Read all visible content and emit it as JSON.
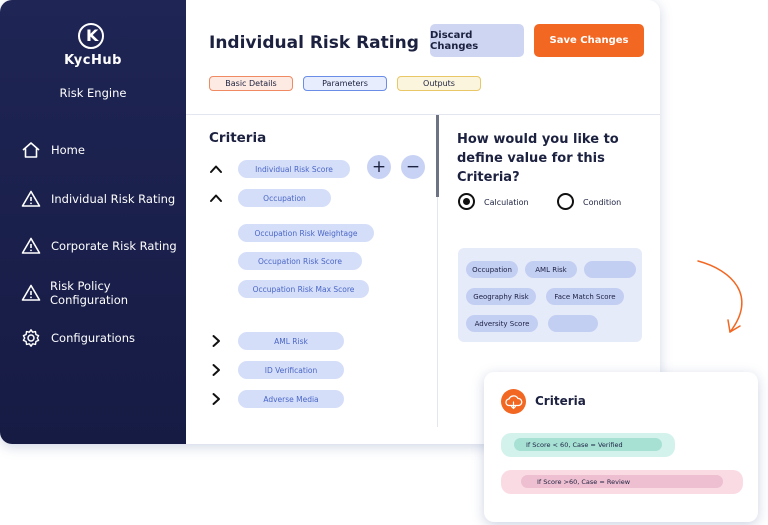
{
  "sidebar": {
    "logo_mark": "K",
    "logo_text": "KycHub",
    "subtitle": "Risk Engine",
    "items": [
      {
        "label": "Home",
        "icon": "home-icon"
      },
      {
        "label": "Individual Risk Rating",
        "icon": "warning-icon"
      },
      {
        "label": "Corporate Risk Rating",
        "icon": "warning-icon"
      },
      {
        "label": "Risk Policy Configuration",
        "icon": "warning-icon"
      },
      {
        "label": "Configurations",
        "icon": "gear-icon"
      }
    ]
  },
  "header": {
    "title": "Individual Risk Rating",
    "discard_label": "Discard Changes",
    "save_label": "Save Changes"
  },
  "tabs": [
    {
      "label": "Basic Details",
      "color": "#f08a62"
    },
    {
      "label": "Parameters",
      "color": "#6a8ee8"
    },
    {
      "label": "Outputs",
      "color": "#e9c766"
    }
  ],
  "criteria": {
    "title": "Criteria",
    "items": [
      {
        "label": "Individual Risk Score",
        "expanded": true
      },
      {
        "label": "Occupation",
        "expanded": true
      },
      {
        "label": "Occupation Risk Weightage"
      },
      {
        "label": "Occupation Risk Score"
      },
      {
        "label": "Occupation Risk Max Score"
      },
      {
        "label": "AML Risk",
        "expanded": false
      },
      {
        "label": "ID Verification",
        "expanded": false
      },
      {
        "label": "Adverse Media",
        "expanded": false
      }
    ],
    "add_symbol": "+",
    "remove_symbol": "−"
  },
  "define": {
    "question": "How would you like to define value for this Criteria?",
    "options": [
      {
        "label": "Calculation",
        "selected": true
      },
      {
        "label": "Condition",
        "selected": false
      }
    ],
    "fields": [
      "Occupation",
      "AML Risk",
      "",
      "Geography Risk",
      "Face Match Score",
      "Adversity Score",
      ""
    ]
  },
  "card": {
    "title": "Criteria",
    "rules": [
      {
        "text": "If Score < 60, Case = Verified",
        "color": "#d4f2ec"
      },
      {
        "text": "If Score >60, Case = Review",
        "color": "#fadbe4"
      }
    ]
  },
  "colors": {
    "accent": "#f26722",
    "sidebar": "#1f2554"
  }
}
